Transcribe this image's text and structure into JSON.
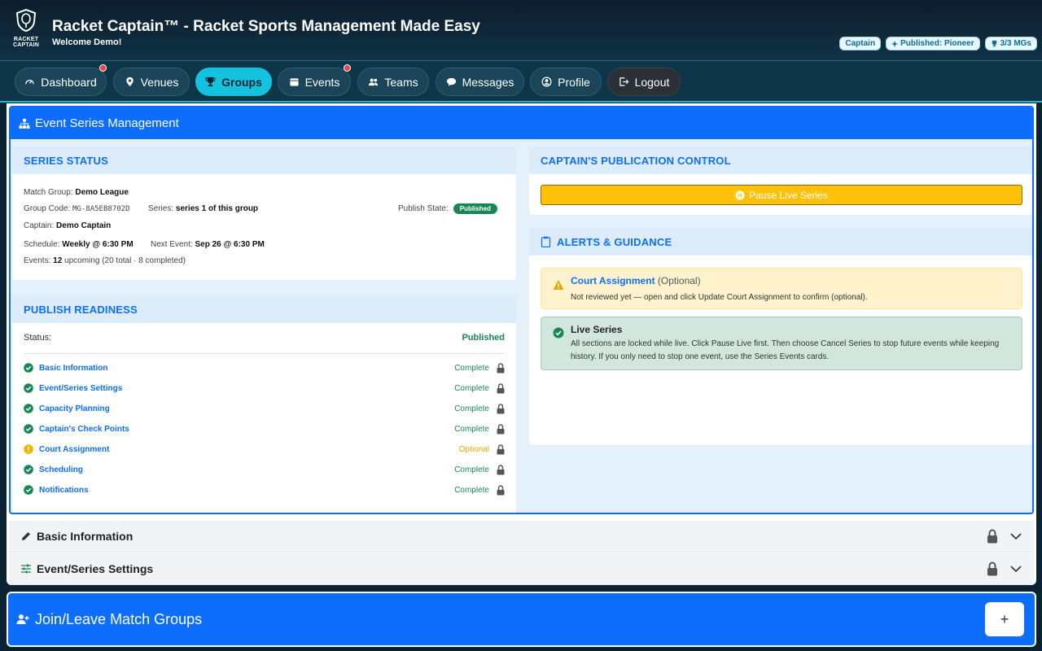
{
  "header": {
    "logo_text_1": "RACKET",
    "logo_text_2": "CAPTAIN",
    "title": "Racket Captain™ - Racket Sports Management Made Easy",
    "welcome": "Welcome Demo!",
    "badges": [
      "Captain",
      "Published: Pioneer",
      "3/3 MGs"
    ]
  },
  "nav": {
    "items": [
      {
        "label": "Dashboard",
        "icon": "gauge-icon"
      },
      {
        "label": "Venues",
        "icon": "map-pin-icon"
      },
      {
        "label": "Groups",
        "icon": "trophy-icon",
        "active": true
      },
      {
        "label": "Events",
        "icon": "calendar-icon"
      },
      {
        "label": "Teams",
        "icon": "people-icon"
      },
      {
        "label": "Messages",
        "icon": "chat-icon"
      },
      {
        "label": "Profile",
        "icon": "person-circle-icon"
      },
      {
        "label": "Logout",
        "icon": "logout-icon"
      }
    ]
  },
  "esm": {
    "title": "Event Series Management",
    "series_status": {
      "heading": "Series Status",
      "match_group_label": "Match Group:",
      "match_group": "Demo League",
      "group_code_label": "Group Code:",
      "group_code": "MG-8A5EB8702D",
      "series_label": "Series:",
      "series": "series 1 of this group",
      "publish_state_label": "Publish State:",
      "publish_state": "Published",
      "captain_label": "Captain:",
      "captain": "Demo Captain",
      "schedule_label": "Schedule:",
      "schedule": "Weekly @ 6:30 PM",
      "next_event_label": "Next Event:",
      "next_event": "Sep 26 @ 6:30 PM",
      "events_label": "Events:",
      "events_upcoming": "12",
      "events_upcoming_suffix": "upcoming",
      "events_detail": "(20 total · 8 completed)"
    },
    "publish_readiness": {
      "heading": "Publish Readiness",
      "status_label": "Status:",
      "status_value": "Published",
      "items": [
        {
          "label": "Basic Information",
          "status": "Complete"
        },
        {
          "label": "Event/Series Settings",
          "status": "Complete"
        },
        {
          "label": "Capacity Planning",
          "status": "Complete"
        },
        {
          "label": "Captain's Check Points",
          "status": "Complete"
        },
        {
          "label": "Court Assignment",
          "status": "Optional"
        },
        {
          "label": "Scheduling",
          "status": "Complete"
        },
        {
          "label": "Notifications",
          "status": "Complete"
        }
      ]
    },
    "publication_control": {
      "heading": "Captain's Publication Control",
      "pause_label": "Pause Live Series"
    },
    "alerts": {
      "heading": "Alerts & Guidance",
      "court_title": "Court Assignment",
      "court_suffix": "(Optional)",
      "court_desc": "Not reviewed yet — open and click Update Court Assignment to confirm (optional).",
      "live_title": "Live Series",
      "live_desc": "All sections are locked while live. Click Pause Live first. Then choose Cancel Series to stop future events while keeping history. If you only need to stop one event, use the Series Events cards."
    }
  },
  "accordions": [
    {
      "label": "Basic Information",
      "icon": "pencil-icon"
    },
    {
      "label": "Event/Series Settings",
      "icon": "sliders-icon"
    }
  ],
  "join": {
    "title": "Join/Leave Match Groups",
    "add_label": "+"
  },
  "colors": {
    "primary": "#0d6efd",
    "accent": "#13c3dd",
    "success": "#198754",
    "warning": "#ffc107"
  }
}
